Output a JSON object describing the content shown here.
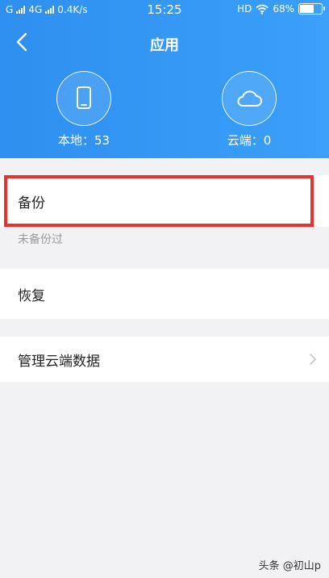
{
  "status_bar": {
    "network_left": "G",
    "network_mid": "4G",
    "speed": "0.4K/s",
    "time": "15:25",
    "hd": "HD",
    "battery": "68%"
  },
  "header": {
    "title": "应用",
    "back_icon": "back-arrow-icon",
    "local": {
      "label": "本地：53",
      "icon": "phone-icon"
    },
    "cloud": {
      "label": "云端：0",
      "icon": "cloud-icon"
    }
  },
  "menu": {
    "backup": {
      "label": "备份",
      "note": "未备份过"
    },
    "restore": {
      "label": "恢复"
    },
    "manage": {
      "label": "管理云端数据",
      "icon": "chevron-right-icon"
    }
  },
  "watermark": "头条 @初山p",
  "colors": {
    "header_blue": "#2f8ff0",
    "highlight_red": "#e53333",
    "background": "#f2f2f4"
  }
}
